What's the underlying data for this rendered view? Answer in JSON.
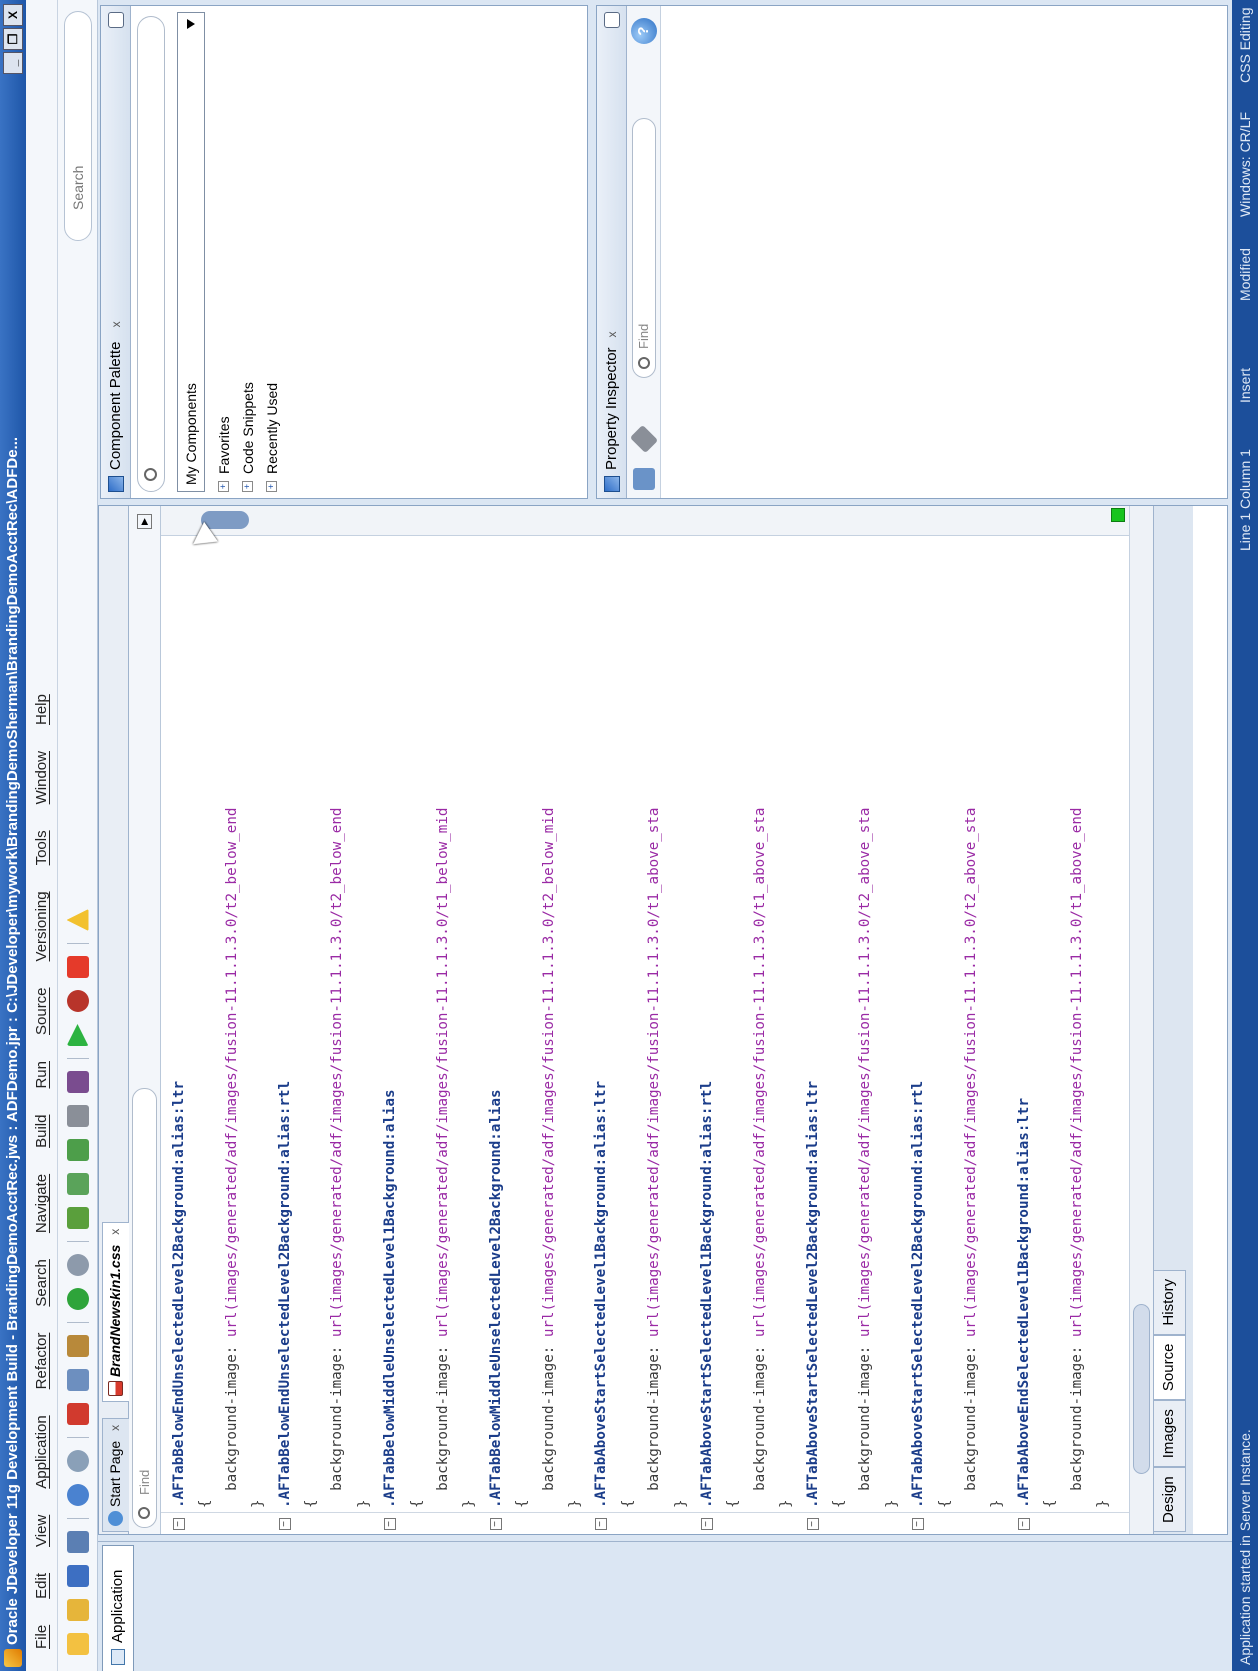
{
  "window": {
    "title": "Oracle JDeveloper 11g Development Build - BrandingDemoAcctRec.jws : ADFDemo.jpr : C:\\JDeveloper\\mywork\\BrandingDemoSherman\\BrandingDemoAcctRec\\ADFDe...",
    "controls": [
      "_",
      "❐",
      "X"
    ]
  },
  "menu": [
    "File",
    "Edit",
    "View",
    "Application",
    "Refactor",
    "Search",
    "Navigate",
    "Build",
    "Run",
    "Source",
    "Versioning",
    "Tools",
    "Window",
    "Help"
  ],
  "search": {
    "placeholder": "Search"
  },
  "left_tab": {
    "label": "Application"
  },
  "tabs": [
    {
      "label": "Start Page"
    },
    {
      "label": "BrandNewskin1.css"
    }
  ],
  "find": {
    "placeholder": "Find"
  },
  "code_lines": [
    {
      "type": "sel",
      "text": ".AFTabBelowEndUnselectedLevel2Background:alias:ltr"
    },
    {
      "type": "brace",
      "text": "{"
    },
    {
      "type": "decl",
      "prop": "  background-image: ",
      "value": "url(images/generated/adf/images/fusion-11.1.1.3.0/t2_below_end"
    },
    {
      "type": "brace",
      "text": "}"
    },
    {
      "type": "sel",
      "text": ".AFTabBelowEndUnselectedLevel2Background:alias:rtl"
    },
    {
      "type": "brace",
      "text": "{"
    },
    {
      "type": "decl",
      "prop": "  background-image: ",
      "value": "url(images/generated/adf/images/fusion-11.1.1.3.0/t2_below_end"
    },
    {
      "type": "brace",
      "text": "}"
    },
    {
      "type": "sel",
      "text": ".AFTabBelowMiddleUnselectedLevel1Background:alias"
    },
    {
      "type": "brace",
      "text": "{"
    },
    {
      "type": "decl",
      "prop": "  background-image: ",
      "value": "url(images/generated/adf/images/fusion-11.1.1.3.0/t1_below_mid"
    },
    {
      "type": "brace",
      "text": "}"
    },
    {
      "type": "sel",
      "text": ".AFTabBelowMiddleUnselectedLevel2Background:alias"
    },
    {
      "type": "brace",
      "text": "{"
    },
    {
      "type": "decl",
      "prop": "  background-image: ",
      "value": "url(images/generated/adf/images/fusion-11.1.1.3.0/t2_below_mid"
    },
    {
      "type": "brace",
      "text": "}"
    },
    {
      "type": "sel",
      "text": ".AFTabAboveStartSelectedLevel1Background:alias:ltr"
    },
    {
      "type": "brace",
      "text": "{"
    },
    {
      "type": "decl",
      "prop": "  background-image: ",
      "value": "url(images/generated/adf/images/fusion-11.1.1.3.0/t1_above_sta"
    },
    {
      "type": "brace",
      "text": "}"
    },
    {
      "type": "sel",
      "text": ".AFTabAboveStartSelectedLevel1Background:alias:rtl"
    },
    {
      "type": "brace",
      "text": "{"
    },
    {
      "type": "decl",
      "prop": "  background-image: ",
      "value": "url(images/generated/adf/images/fusion-11.1.1.3.0/t1_above_sta"
    },
    {
      "type": "brace",
      "text": "}"
    },
    {
      "type": "sel",
      "text": ".AFTabAboveStartSelectedLevel2Background:alias:ltr"
    },
    {
      "type": "brace",
      "text": "{"
    },
    {
      "type": "decl",
      "prop": "  background-image: ",
      "value": "url(images/generated/adf/images/fusion-11.1.1.3.0/t2_above_sta"
    },
    {
      "type": "brace",
      "text": "}"
    },
    {
      "type": "sel",
      "text": ".AFTabAboveStartSelectedLevel2Background:alias:rtl"
    },
    {
      "type": "brace",
      "text": "{"
    },
    {
      "type": "decl",
      "prop": "  background-image: ",
      "value": "url(images/generated/adf/images/fusion-11.1.1.3.0/t2_above_sta"
    },
    {
      "type": "brace",
      "text": "}"
    },
    {
      "type": "sel",
      "text": ".AFTabAboveEndSelectedLevel1Background:alias:ltr"
    },
    {
      "type": "brace",
      "text": "{"
    },
    {
      "type": "decl",
      "prop": "  background-image: ",
      "value": "url(images/generated/adf/images/fusion-11.1.1.3.0/t1_above_end"
    },
    {
      "type": "brace",
      "text": "}"
    }
  ],
  "editor_tabs": [
    "Design",
    "Images",
    "Source",
    "History"
  ],
  "editor_active_tab": "Source",
  "component_palette": {
    "title": "Component Palette",
    "dropdown": "My Components",
    "items": [
      "Favorites",
      "Code Snippets",
      "Recently Used"
    ]
  },
  "property_inspector": {
    "title": "Property Inspector",
    "find_placeholder": "Find"
  },
  "status": {
    "message": "Application started in Server Instance.",
    "position": "Line 1 Column 1",
    "mode": "Insert",
    "state": "Modified",
    "line_endings": "Windows: CR/LF",
    "editor": "CSS Editing"
  },
  "colors": {
    "title_bar": "#1e56a8",
    "status_bar": "#1c4f9b",
    "selector_text": "#1b3d8a",
    "value_text": "#9a2aa5",
    "indicator_green": "#18c41e"
  }
}
